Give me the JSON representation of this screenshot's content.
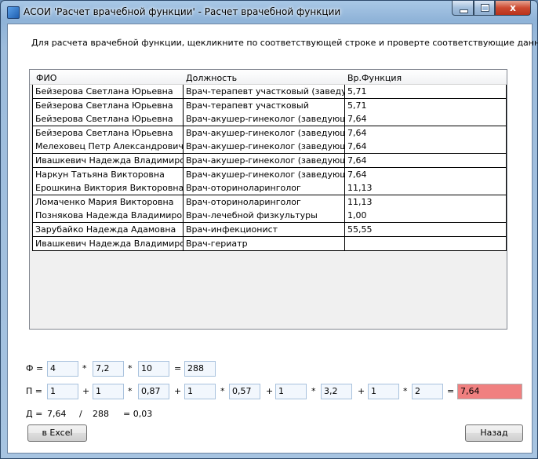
{
  "window": {
    "title": "АСОИ 'Расчет врачебной функции' - Расчет врачебной функции",
    "buttons": {
      "minimize": "minimize",
      "maximize": "maximize",
      "close": "x"
    }
  },
  "instruction": "Для расчета врачебной функции, щекликните по соответствующей строке и проверте соответствующие данные",
  "grid": {
    "columns": [
      "ФИО",
      "Должность",
      "Вр.Функция"
    ],
    "rows": [
      [
        "Бейзерова Светлана Юрьевна",
        "Врач-терапевт участковый (заведующи",
        "5,71"
      ],
      [
        "Бейзерова Светлана Юрьевна",
        "Врач-терапевт участковый",
        "5,71"
      ],
      [
        "Бейзерова Светлана Юрьевна",
        "Врач-акушер-гинеколог (заведующий)",
        "7,64"
      ],
      [
        "Бейзерова Светлана Юрьевна",
        "Врач-акушер-гинеколог (заведующий)",
        "7,64"
      ],
      [
        "Мелеховец Петр Александрович",
        "Врач-акушер-гинеколог (заведующий)",
        "7,64"
      ],
      [
        "Ивашкевич Надежда Владимировна",
        "Врач-акушер-гинеколог (заведующий)",
        "7,64"
      ],
      [
        "Наркун Татьяна Викторовна",
        "Врач-акушер-гинеколог (заведующий)",
        "7,64"
      ],
      [
        "Ерошкина Виктория Викторовна",
        "Врач-оториноларинголог",
        "11,13"
      ],
      [
        "Ломаченко Мария Викторовна",
        "Врач-оториноларинголог",
        "11,13"
      ],
      [
        "Познякова Надежда Владимировна",
        "Врач-лечебной физкультуры",
        "1,00"
      ],
      [
        "Зарубайко Надежда Адамовна",
        "Врач-инфекционист",
        "55,55"
      ],
      [
        "Ивашкевич Надежда Владимировна",
        "Врач-гериатр",
        ""
      ]
    ]
  },
  "phi": {
    "label": "Ф =",
    "v1": "4",
    "op1": "*",
    "v2": "7,2",
    "op2": "*",
    "v3": "10",
    "eq": "=",
    "result": "288"
  },
  "pi": {
    "label": "П =",
    "a1": "1",
    "plus1": "+",
    "a2": "1",
    "mul1": "*",
    "a3": "0,87",
    "plus2": "+",
    "a4": "1",
    "mul2": "*",
    "a5": "0,57",
    "plus3": "+",
    "a6": "1",
    "mul3": "*",
    "a7": "3,2",
    "plus4": "+",
    "a8": "1",
    "mul4": "*",
    "a9": "2",
    "eq": "=",
    "result": "7,64"
  },
  "d": {
    "label": "Д =",
    "numerator": "7,64",
    "slash": "/",
    "denominator": "288",
    "result": "= 0,03"
  },
  "buttons": {
    "excel": "в Excel",
    "back": "Назад"
  },
  "colors": {
    "result_highlight": "#f08080",
    "input_background": "#f2f7fd"
  }
}
